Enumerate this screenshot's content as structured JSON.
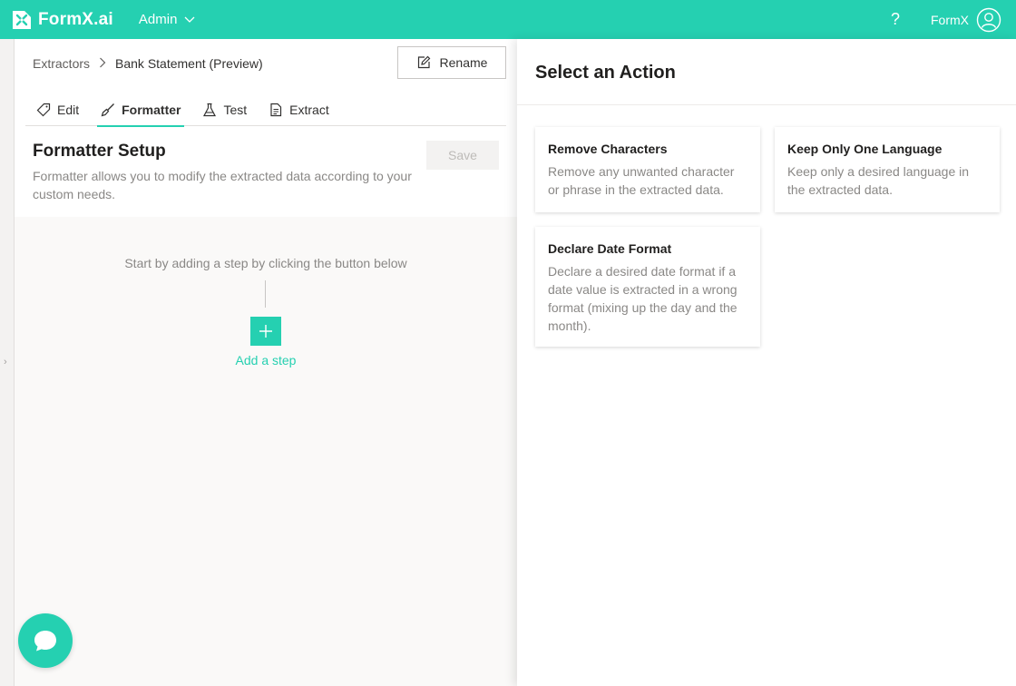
{
  "app": {
    "brand": "FormX.ai",
    "workspace": "Admin",
    "help_label": "?",
    "user_name": "FormX"
  },
  "breadcrumb": {
    "parent": "Extractors",
    "current": "Bank Statement (Preview)"
  },
  "rename_label": "Rename",
  "tabs": [
    {
      "label": "Edit",
      "icon": "tag-icon"
    },
    {
      "label": "Formatter",
      "icon": "brush-icon",
      "active": true
    },
    {
      "label": "Test",
      "icon": "flask-icon"
    },
    {
      "label": "Extract",
      "icon": "document-icon"
    }
  ],
  "formatter": {
    "title": "Formatter Setup",
    "description": "Formatter allows you to modify the extracted data according to your custom needs.",
    "save_label": "Save",
    "empty_hint": "Start by adding a step by clicking the button below",
    "add_step_label": "Add a step"
  },
  "action_panel": {
    "title": "Select an Action",
    "actions": [
      {
        "title": "Remove Characters",
        "description": "Remove any unwanted character or phrase in the extracted data."
      },
      {
        "title": "Keep Only One Language",
        "description": "Keep only a desired language in the extracted data."
      },
      {
        "title": "Declare Date Format",
        "description": "Declare a desired date format if a date value is extracted in a wrong format (mixing up the day and the month)."
      }
    ]
  },
  "colors": {
    "accent": "#25d0b1",
    "muted_text": "#8a8886"
  }
}
